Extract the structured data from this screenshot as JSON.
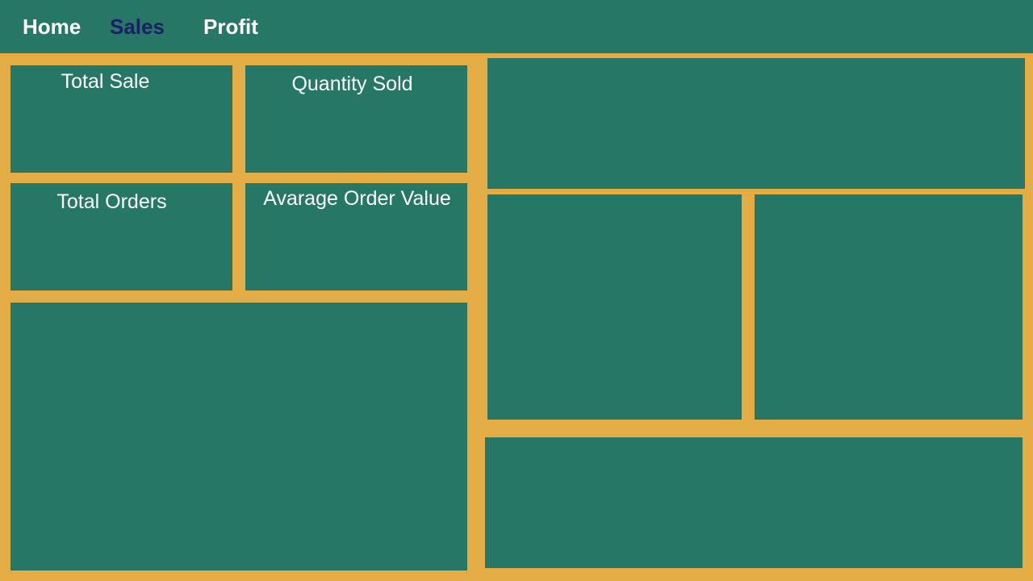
{
  "nav": {
    "home_label": "Home",
    "sales_label": "Sales",
    "profit_label": "Profit",
    "active": "Sales"
  },
  "kpis": {
    "total_sale": "Total Sale",
    "quantity_sold": "Quantity Sold",
    "total_orders": "Total Orders",
    "avg_order_value": "Avarage Order Value"
  },
  "colors": {
    "background": "#e4ac45",
    "panel": "#277766",
    "nav_text": "#ffffff",
    "nav_active_text": "#1a2063"
  }
}
